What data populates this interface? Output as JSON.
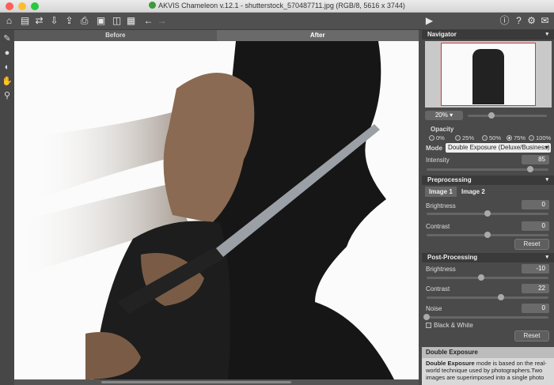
{
  "window": {
    "title": "AKVIS Chameleon v.12.1 - shutterstock_570487711.jpg (RGB/8, 5616 x 3744)"
  },
  "tabs": {
    "before": "Before",
    "after": "After"
  },
  "navigator": {
    "title": "Navigator",
    "zoom": "20%"
  },
  "opacity": {
    "label": "Opacity",
    "options": [
      "0%",
      "25%",
      "50%",
      "75%",
      "100%"
    ],
    "selected": "75%"
  },
  "mode": {
    "label": "Mode",
    "value": "Double Exposure (Deluxe/Business)"
  },
  "intensity": {
    "label": "Intensity",
    "value": "85",
    "level": 0.85
  },
  "preprocessing": {
    "title": "Preprocessing",
    "tabs": [
      "Image 1",
      "Image 2"
    ],
    "brightness": {
      "label": "Brightness",
      "value": "0",
      "level": 0.5
    },
    "contrast": {
      "label": "Contrast",
      "value": "0",
      "level": 0.5
    },
    "reset": "Reset"
  },
  "postprocessing": {
    "title": "Post-Processing",
    "brightness": {
      "label": "Brightness",
      "value": "-10",
      "level": 0.45
    },
    "contrast": {
      "label": "Contrast",
      "value": "22",
      "level": 0.61
    },
    "noise": {
      "label": "Noise",
      "value": "0",
      "level": 0.0
    },
    "bw_label": "Black & White",
    "reset": "Reset"
  },
  "help": {
    "title": "Double Exposure",
    "bold": "Double Exposure",
    "text": " mode is based on the real-world technique used by photographers.Two images are superimposed into a single photo"
  }
}
